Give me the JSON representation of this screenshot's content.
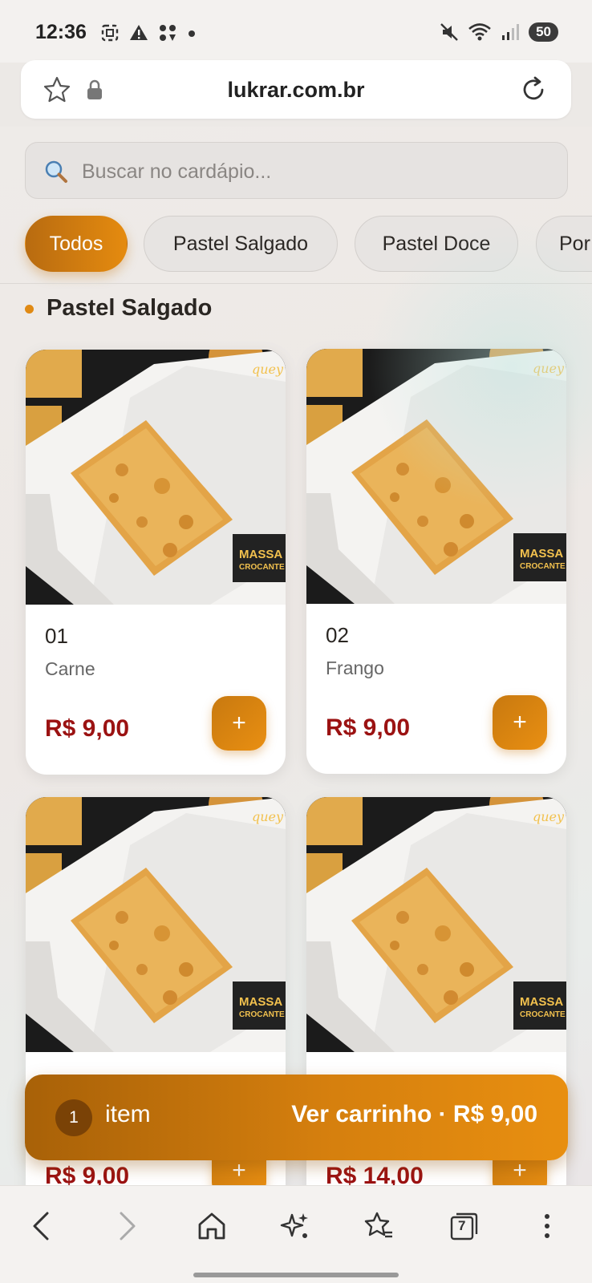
{
  "status_bar": {
    "time": "12:36",
    "battery": "50"
  },
  "browser": {
    "url": "lukrar.com.br"
  },
  "search": {
    "placeholder": "Buscar no cardápio..."
  },
  "categories": [
    {
      "label": "Todos",
      "active": true
    },
    {
      "label": "Pastel Salgado",
      "active": false
    },
    {
      "label": "Pastel Doce",
      "active": false
    },
    {
      "label": "Por",
      "active": false
    }
  ],
  "section": {
    "title": "Pastel Salgado"
  },
  "products": [
    {
      "code": "01",
      "name": "Carne",
      "price": "R$ 9,00",
      "add_label": "+"
    },
    {
      "code": "02",
      "name": "Frango",
      "price": "R$ 9,00",
      "add_label": "+"
    },
    {
      "code": "",
      "name": "",
      "price": "R$ 9,00",
      "add_label": "+"
    },
    {
      "code": "",
      "name": "",
      "price": "R$ 14,00",
      "add_label": "+"
    }
  ],
  "photo_text": {
    "brand": "quey",
    "massa": "MASSA",
    "crocante": "CROCANTE"
  },
  "cart": {
    "count": "1",
    "item_label": "item",
    "cta": "Ver carrinho · R$ 9,00"
  },
  "bottom_nav": {
    "tabs_count": "7"
  },
  "colors": {
    "accent": "#e08a14",
    "price": "#9b1212"
  }
}
